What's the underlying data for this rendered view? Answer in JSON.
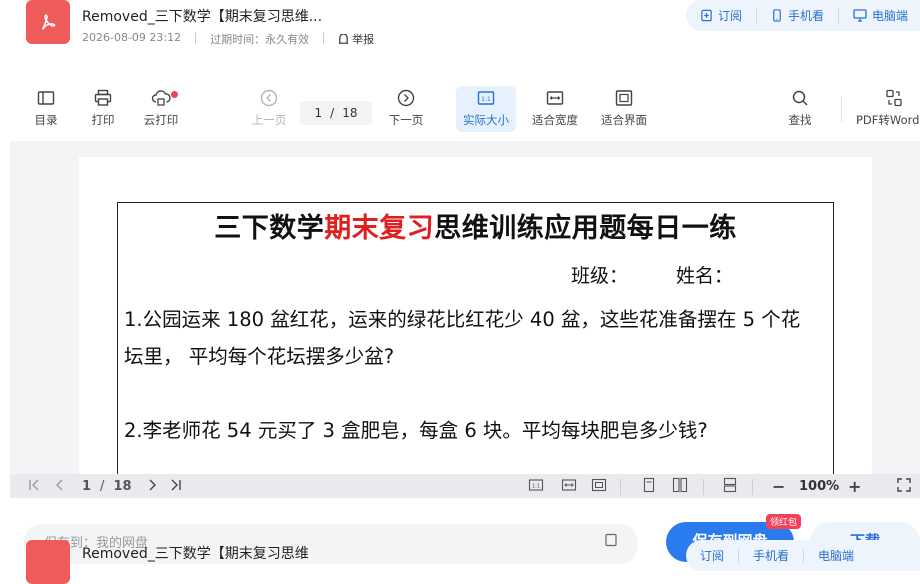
{
  "header": {
    "title": "Removed_三下数学【期末复习思维...",
    "date": "2026-08-09 23:12",
    "expiry_label": "过期时间：永久有效",
    "report": "举报",
    "actions": {
      "subscribe": "订阅",
      "mobile": "手机看",
      "desktop": "电脑端"
    }
  },
  "toolbar": {
    "catalog": "目录",
    "print": "打印",
    "cloud_print": "云打印",
    "prev": "上一页",
    "page_current": "1",
    "page_sep": "/",
    "page_total": "18",
    "next": "下一页",
    "actual_size": "实际大小",
    "fit_width": "适合宽度",
    "fit_page": "适合界面",
    "find": "查找",
    "pdf_convert": "PDF转Word"
  },
  "document": {
    "title_prefix": "三下数学",
    "title_highlight": "期末复习",
    "title_suffix": "思维训练应用题每日一练",
    "class_label": "班级：",
    "name_label": "姓名：",
    "q1_line1": "1.公园运来 180 盆红花，运来的绿花比红花少 40 盆，这些花准备摆在 5 个花",
    "q1_line2": "坛里，  平均每个花坛摆多少盆?",
    "q2_line1": "2.李老师花 54 元买了 3 盒肥皂，每盒 6 块。平均每块肥皂多少钱?"
  },
  "viewer_bar": {
    "page_current": "1",
    "page_sep": "/",
    "page_total": "18",
    "zoom": "100%",
    "minus": "−",
    "plus": "+"
  },
  "footer": {
    "save_to": "保存到：我的网盘",
    "save_button": "保存到网盘",
    "red_tag": "领红包",
    "download": "下载",
    "title_dup": "Removed_三下数学【期末复习思维",
    "subscribe": "订阅",
    "mobile": "手机看",
    "desktop": "电脑端"
  },
  "colors": {
    "accent": "#2a6fd6",
    "highlight_red": "#e02020",
    "pdf_icon": "#ef5a5a"
  }
}
